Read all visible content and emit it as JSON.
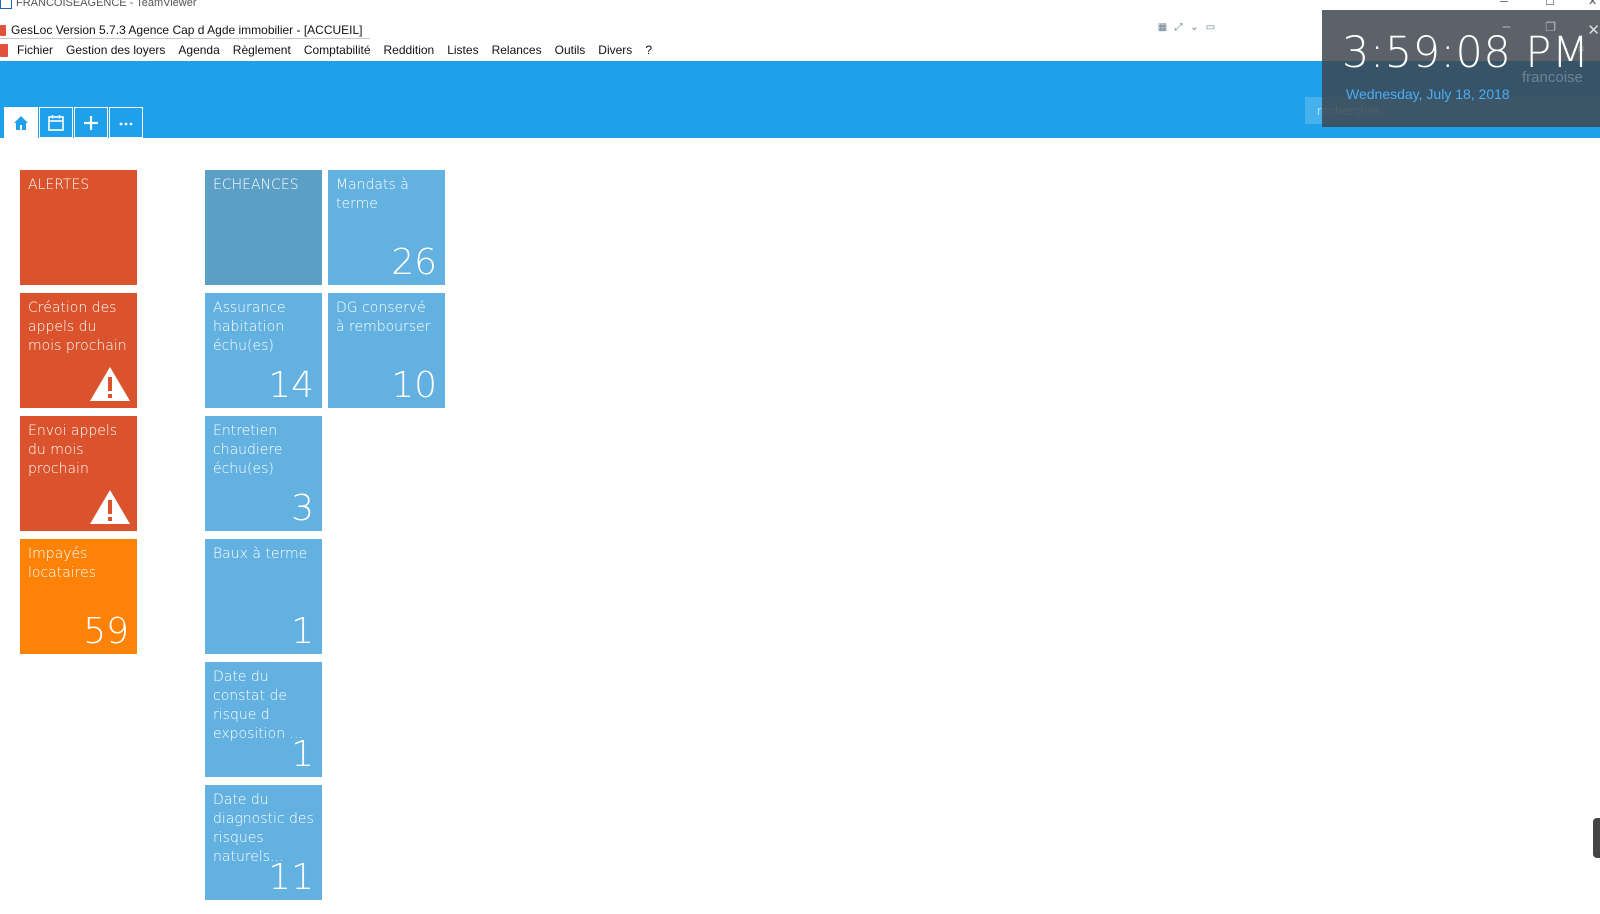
{
  "teamviewer": {
    "title": "FRANCOISEAGENCE - TeamViewer"
  },
  "app": {
    "title": "GesLoc  Version 5.7.3  Agence Cap d Agde immobilier - [ACCUEIL]"
  },
  "menu": {
    "items": [
      "Fichier",
      "Gestion des loyers",
      "Agenda",
      "Règlement",
      "Comptabilité",
      "Reddition",
      "Listes",
      "Relances",
      "Outils",
      "Divers",
      "?"
    ]
  },
  "header": {
    "nav": [
      {
        "icon": "home-icon"
      },
      {
        "icon": "calendar-icon"
      },
      {
        "icon": "plus-icon"
      },
      {
        "icon": "more-icon"
      }
    ],
    "search": {
      "placeholder": "rechercher...",
      "value": ""
    }
  },
  "clock": {
    "time": "3:59:08 PM",
    "date": "Wednesday, July 18, 2018",
    "user": "francoise"
  },
  "colors": {
    "header_blue": "#1ea1ea",
    "alert_red": "#db532c",
    "unpaid_orange": "#fd8308",
    "echeances_grey_blue": "#5b9fc7",
    "tile_light_blue": "#62b1e0"
  },
  "tiles": {
    "alertes": {
      "label": "ALERTES",
      "value": ""
    },
    "creation_appels": {
      "label": "Création des appels du mois prochain",
      "icon": "warning-icon"
    },
    "envoi_appels": {
      "label": "Envoi appels du mois prochain",
      "icon": "warning-icon"
    },
    "impayes": {
      "label": "Impayés locataires",
      "value": "59"
    },
    "echeances": {
      "label": "ECHEANCES",
      "value": ""
    },
    "mandats": {
      "label": "Mandats à terme",
      "value": "26"
    },
    "assurance": {
      "label": "Assurance habitation échu(es)",
      "value": "14"
    },
    "dg_conserve": {
      "label": "DG conservé à rembourser",
      "value": "10"
    },
    "entretien": {
      "label": "Entretien chaudiere échu(es)",
      "value": "3"
    },
    "baux": {
      "label": "Baux à terme",
      "value": "1"
    },
    "constat_risque": {
      "label": "Date du constat de risque d exposition ...",
      "value": "1"
    },
    "diagnostic": {
      "label": "Date du diagnostic des risques naturels...",
      "value": "11"
    }
  }
}
